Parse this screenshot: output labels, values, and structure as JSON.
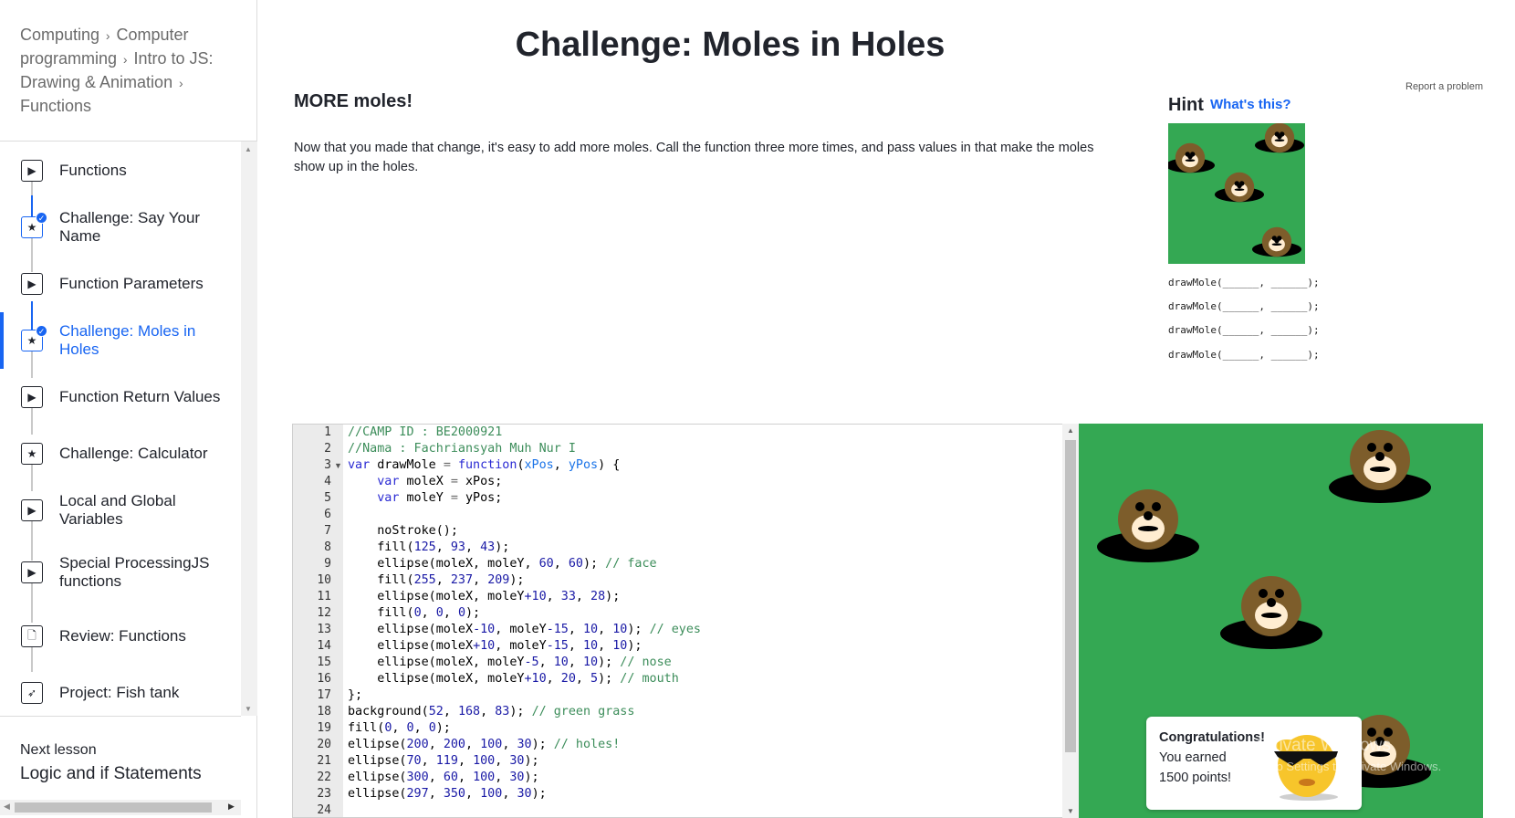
{
  "breadcrumb": [
    "Computing",
    "Computer programming",
    "Intro to JS: Drawing & Animation",
    "Functions"
  ],
  "sidebar": {
    "items": [
      {
        "label": "Functions",
        "icon": "play-icon",
        "done": false,
        "active": false
      },
      {
        "label": "Challenge: Say Your Name",
        "icon": "star-icon",
        "done": true,
        "active": false
      },
      {
        "label": "Function Parameters",
        "icon": "play-icon",
        "done": false,
        "active": false
      },
      {
        "label": "Challenge: Moles in Holes",
        "icon": "star-icon",
        "done": true,
        "active": true
      },
      {
        "label": "Function Return Values",
        "icon": "play-icon",
        "done": false,
        "active": false
      },
      {
        "label": "Challenge: Calculator",
        "icon": "star-icon",
        "done": false,
        "active": false
      },
      {
        "label": "Local and Global Variables",
        "icon": "play-icon",
        "done": false,
        "active": false
      },
      {
        "label": "Special ProcessingJS functions",
        "icon": "play-icon",
        "done": false,
        "active": false
      },
      {
        "label": "Review: Functions",
        "icon": "document-icon",
        "done": false,
        "active": false
      },
      {
        "label": "Project: Fish tank",
        "icon": "rocket-icon",
        "done": false,
        "active": false
      }
    ],
    "next_label": "Next lesson",
    "next_title": "Logic and if Statements"
  },
  "page": {
    "title": "Challenge: Moles in Holes",
    "report": "Report a problem",
    "step_title": "MORE moles!",
    "instructions": "Now that you made that change, it's easy to add more moles. Call the function three more times, and pass values in that make the moles show up in the holes."
  },
  "hint": {
    "title": "Hint",
    "link": "What's this?",
    "lines": [
      "drawMole(______, ______);",
      "drawMole(______, ______);",
      "drawMole(______, ______);",
      "drawMole(______, ______);"
    ]
  },
  "editor": {
    "line_numbers": [
      "1",
      "2",
      "3",
      "4",
      "5",
      "6",
      "7",
      "8",
      "9",
      "10",
      "11",
      "12",
      "13",
      "14",
      "15",
      "16",
      "17",
      "18",
      "19",
      "20",
      "21",
      "22",
      "23",
      "24"
    ]
  },
  "toast": {
    "title": "Congratulations!",
    "line1": "You earned",
    "line2": "1500 points!"
  },
  "watermark": {
    "line1": "Activate Windows",
    "line2": "Go to Settings to activate Windows."
  },
  "colors": {
    "accent": "#1865f2",
    "grass": "#34a853",
    "mole_face": "#7d5d2b",
    "mole_snout": "#ffedd1"
  }
}
